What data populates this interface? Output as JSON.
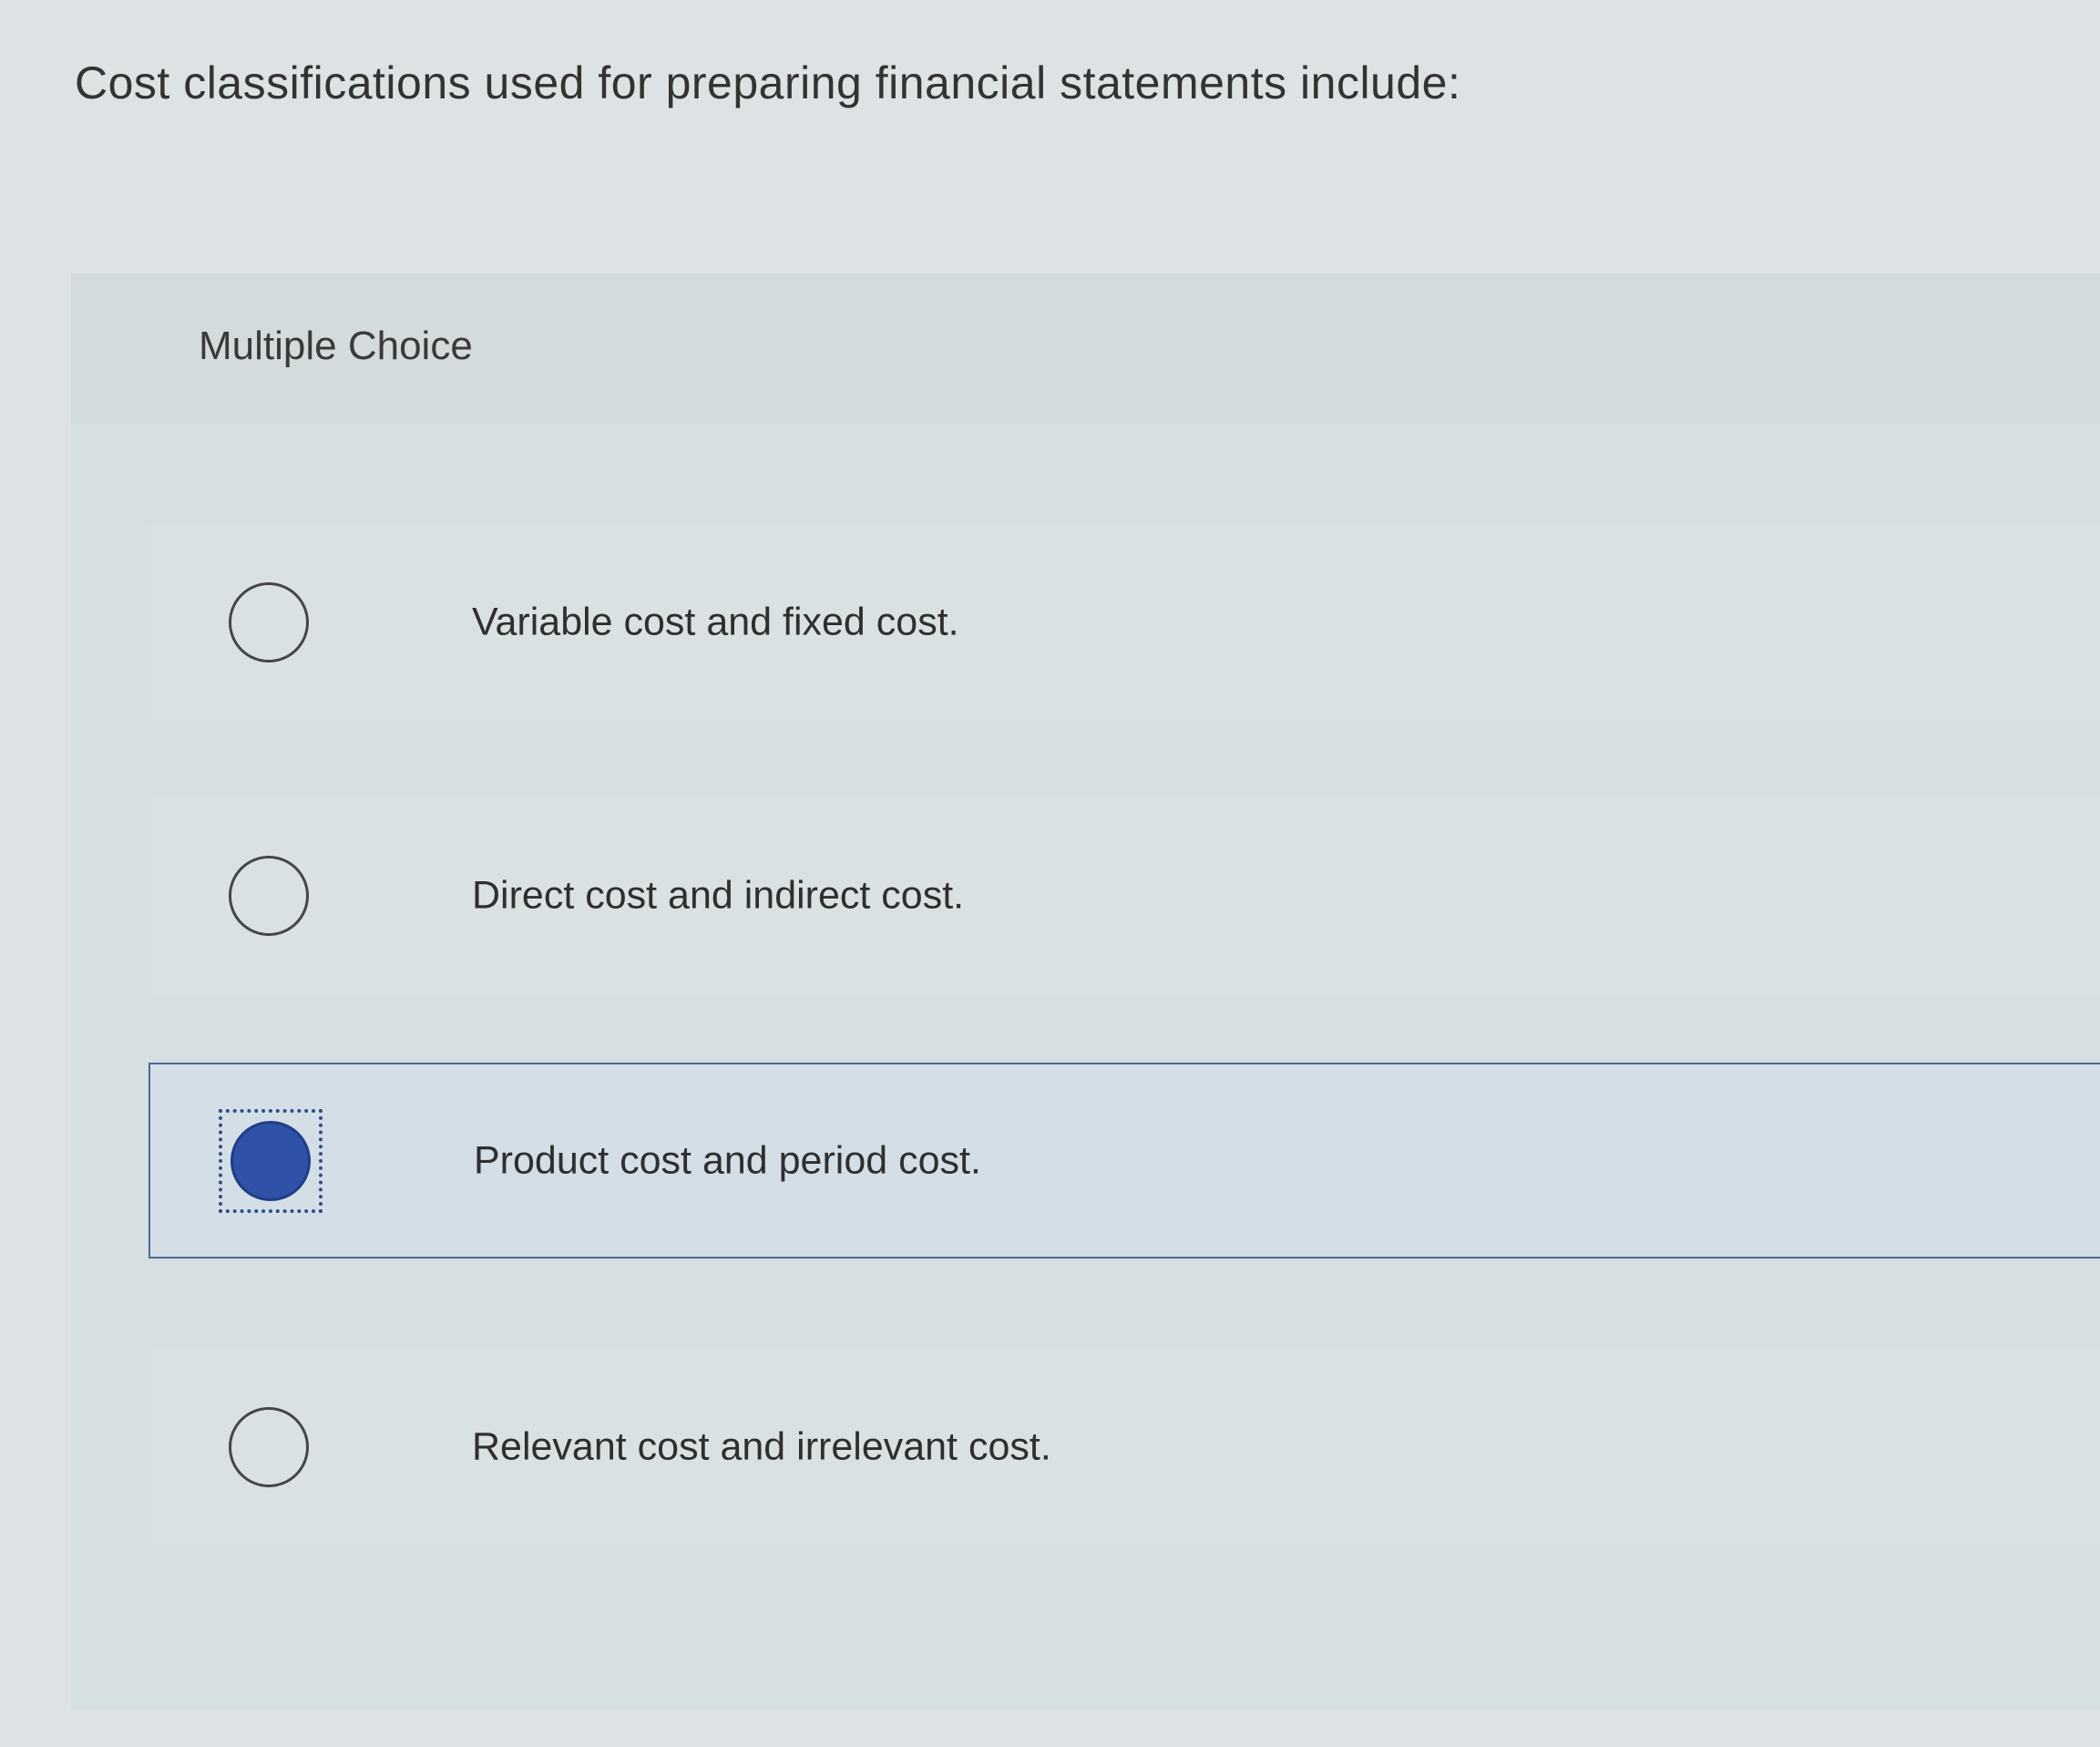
{
  "question": {
    "text": "Cost classifications used for preparing financial statements include:"
  },
  "panel": {
    "label": "Multiple Choice"
  },
  "options": [
    {
      "label": "Variable cost and fixed cost.",
      "selected": false
    },
    {
      "label": "Direct cost and indirect cost.",
      "selected": false
    },
    {
      "label": "Product cost and period cost.",
      "selected": true
    },
    {
      "label": "Relevant cost and irrelevant cost.",
      "selected": false
    }
  ],
  "colors": {
    "selected_fill": "#2f52a8",
    "selected_border": "#4a6a95",
    "background": "#dde3e4"
  }
}
